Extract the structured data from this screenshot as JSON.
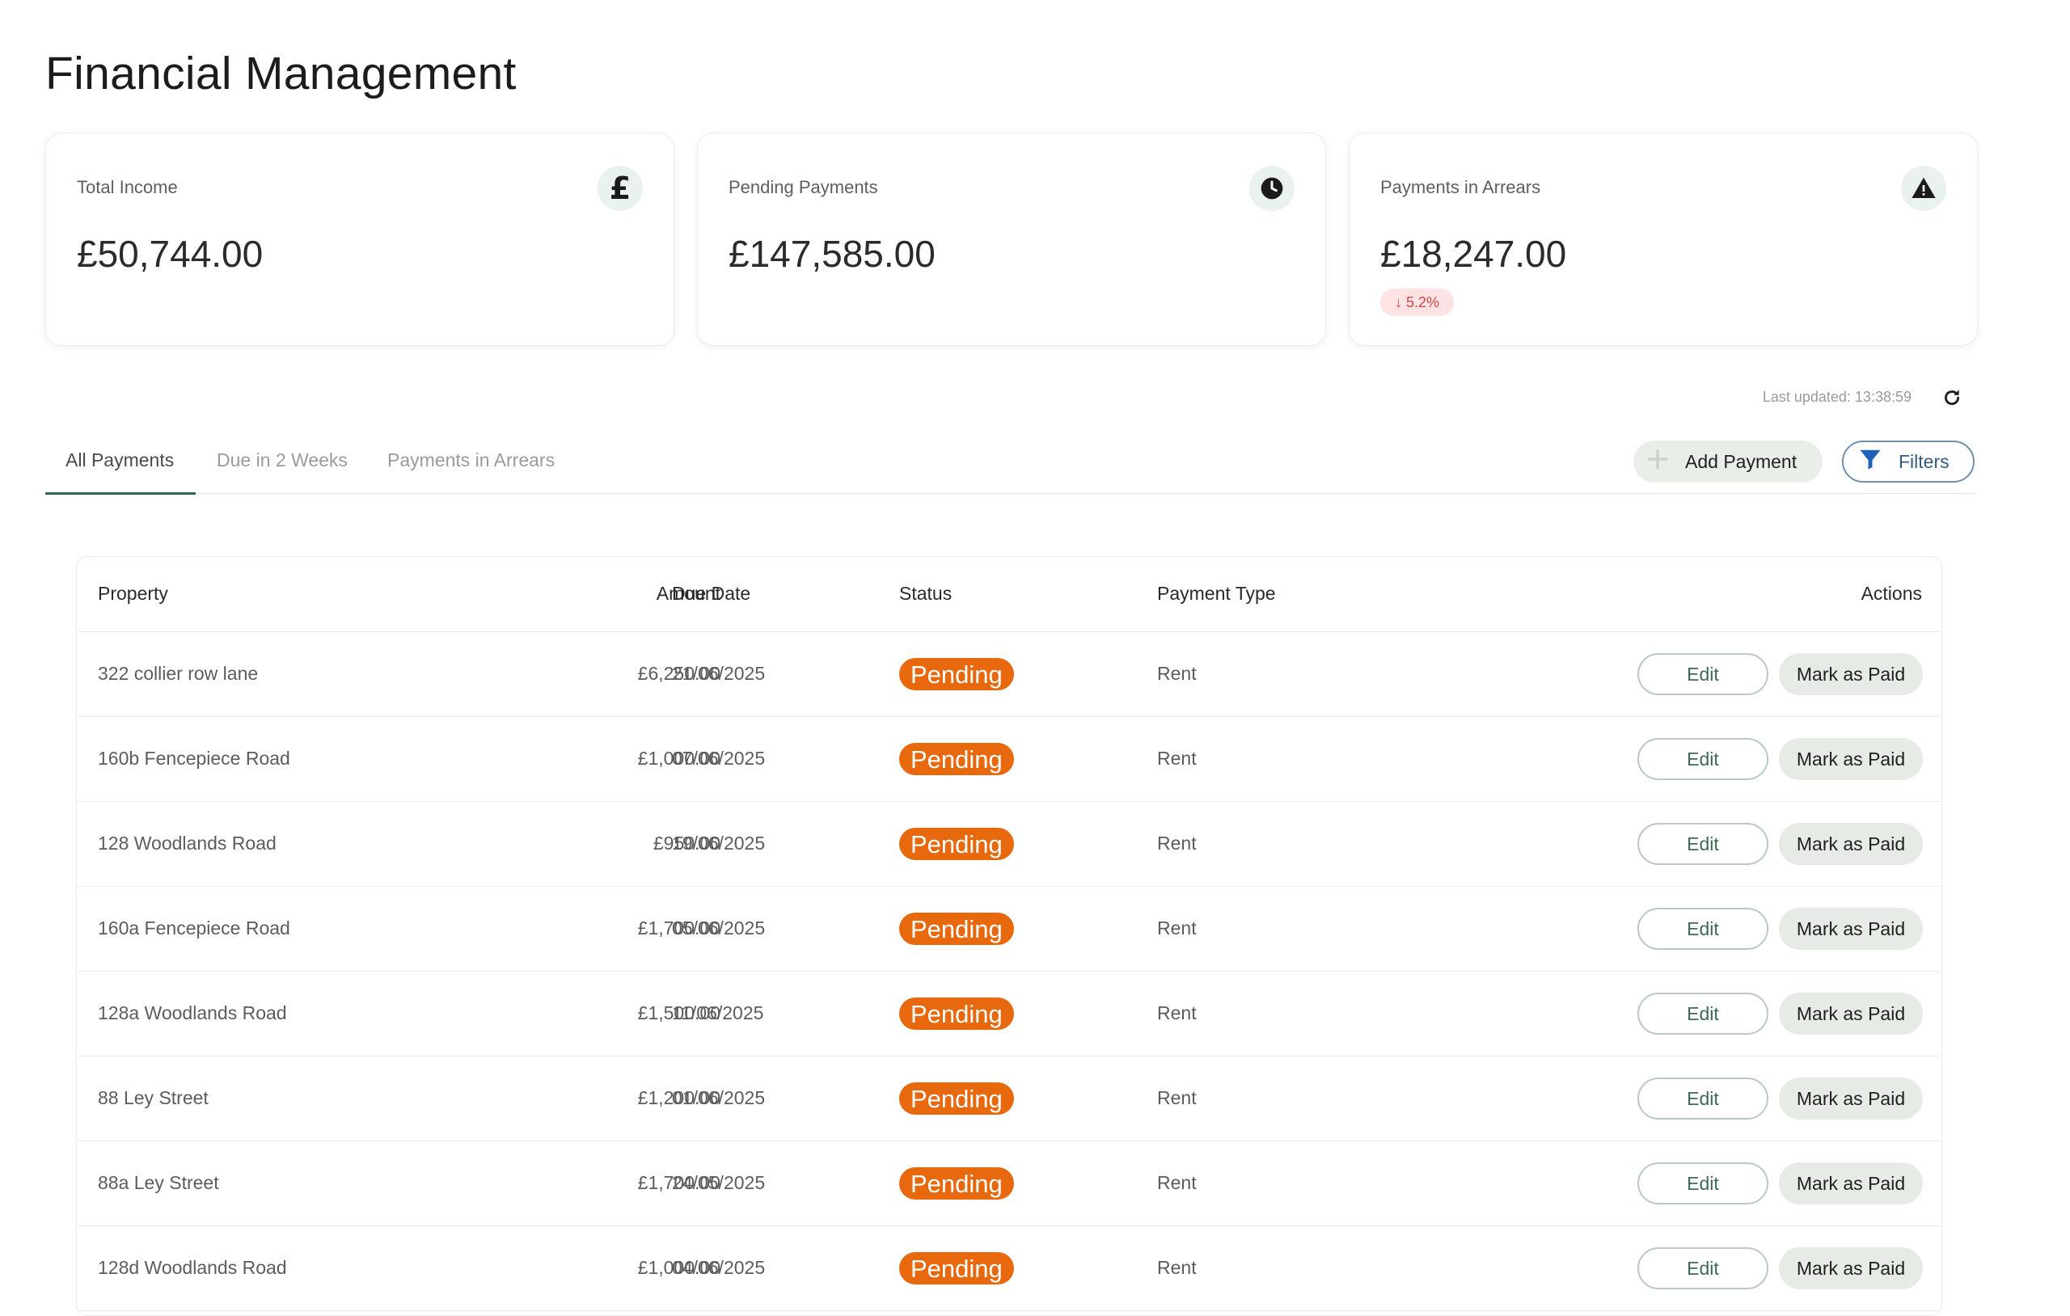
{
  "page": {
    "title": "Financial Management"
  },
  "cards": [
    {
      "label": "Total Income",
      "value": "£50,744.00",
      "icon": "pound-icon"
    },
    {
      "label": "Pending Payments",
      "value": "£147,585.00",
      "icon": "clock-icon"
    },
    {
      "label": "Payments in Arrears",
      "value": "£18,247.00",
      "icon": "warning-icon",
      "badge": "↓ 5.2%"
    }
  ],
  "last_updated": "Last updated: 13:38:59",
  "tabs": [
    {
      "label": "All Payments",
      "active": true
    },
    {
      "label": "Due in 2 Weeks",
      "active": false
    },
    {
      "label": "Payments in Arrears",
      "active": false
    }
  ],
  "toolbar": {
    "add_label": "Add Payment",
    "filters_label": "Filters"
  },
  "table": {
    "headers": {
      "property": "Property",
      "amount": "Amount",
      "due_date": "Due Date",
      "status": "Status",
      "payment_type": "Payment Type",
      "actions": "Actions"
    },
    "edit_label": "Edit",
    "paid_label": "Mark as Paid",
    "rows": [
      {
        "property": "322 collier row lane",
        "amount": "£6,250.00",
        "due_date": "21/06/2025",
        "status": "Pending",
        "payment_type": "Rent"
      },
      {
        "property": "160b Fencepiece Road",
        "amount": "£1,000.00",
        "due_date": "07/06/2025",
        "status": "Pending",
        "payment_type": "Rent"
      },
      {
        "property": "128 Woodlands Road",
        "amount": "£950.00",
        "due_date": "19/06/2025",
        "status": "Pending",
        "payment_type": "Rent"
      },
      {
        "property": "160a Fencepiece Road",
        "amount": "£1,700.00",
        "due_date": "05/06/2025",
        "status": "Pending",
        "payment_type": "Rent"
      },
      {
        "property": "128a Woodlands Road",
        "amount": "£1,500.00",
        "due_date": "11/06/2025",
        "status": "Pending",
        "payment_type": "Rent"
      },
      {
        "property": "88 Ley Street",
        "amount": "£1,200.00",
        "due_date": "01/06/2025",
        "status": "Pending",
        "payment_type": "Rent"
      },
      {
        "property": "88a Ley Street",
        "amount": "£1,700.00",
        "due_date": "24/05/2025",
        "status": "Pending",
        "payment_type": "Rent"
      },
      {
        "property": "128d Woodlands Road",
        "amount": "£1,000.00",
        "due_date": "04/06/2025",
        "status": "Pending",
        "payment_type": "Rent"
      }
    ]
  },
  "colors": {
    "accent": "#2e6b4c",
    "status_pending": "#e8680e",
    "badge_bg": "#fde3e3",
    "badge_text": "#d64545",
    "filters_blue": "#1e63b8"
  }
}
